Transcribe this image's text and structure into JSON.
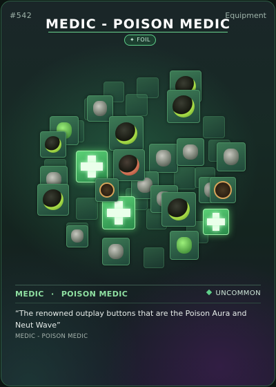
{
  "card": {
    "number": "#542",
    "category": "Equipment",
    "title": "MEDIC - POISON MEDIC",
    "badge": "✦ FOIL",
    "class_name": "MEDIC",
    "separator": "·",
    "spec_name": "POISON MEDIC",
    "rarity": "UNCOMMON",
    "flavor_text": "“The renowned outplay buttons that are the Poison Aura and Neut Wave”",
    "footer": "MEDIC - POISON MEDIC"
  },
  "colors": {
    "accent": "#5fcf8a",
    "title": "#ffffff",
    "class_text": "#8fe0a2"
  }
}
